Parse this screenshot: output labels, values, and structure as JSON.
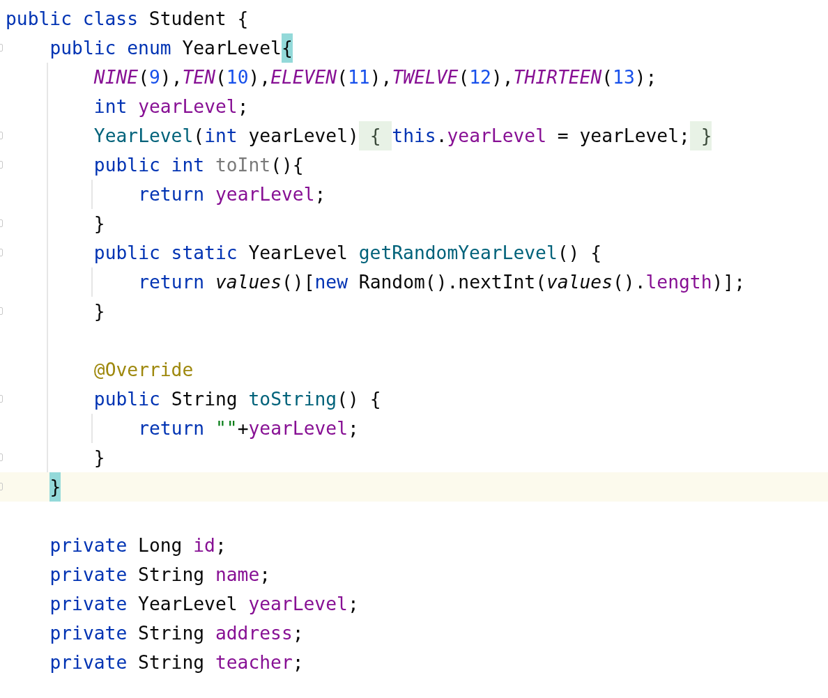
{
  "editor": {
    "lines": [
      {
        "kind": "code",
        "fold_marker": false,
        "current": false,
        "tokens": [
          {
            "text": "public class",
            "kind": "keyword"
          },
          {
            "text": " Student {",
            "kind": "plain"
          }
        ],
        "children": [
          {
            "kind": "code",
            "fold_marker": true,
            "current": false,
            "tokens": [
              {
                "text": "public enum",
                "kind": "keyword"
              },
              {
                "text": " YearLevel",
                "kind": "plain"
              },
              {
                "text": "{",
                "kind": "brace_match"
              }
            ],
            "children": [
              {
                "kind": "code",
                "fold_marker": false,
                "current": false,
                "tokens": [
                  {
                    "text": "NINE",
                    "kind": "constant"
                  },
                  {
                    "text": "(",
                    "kind": "plain"
                  },
                  {
                    "text": "9",
                    "kind": "number"
                  },
                  {
                    "text": "),",
                    "kind": "plain"
                  },
                  {
                    "text": "TEN",
                    "kind": "constant"
                  },
                  {
                    "text": "(",
                    "kind": "plain"
                  },
                  {
                    "text": "10",
                    "kind": "number"
                  },
                  {
                    "text": "),",
                    "kind": "plain"
                  },
                  {
                    "text": "ELEVEN",
                    "kind": "constant"
                  },
                  {
                    "text": "(",
                    "kind": "plain"
                  },
                  {
                    "text": "11",
                    "kind": "number"
                  },
                  {
                    "text": "),",
                    "kind": "plain"
                  },
                  {
                    "text": "TWELVE",
                    "kind": "constant"
                  },
                  {
                    "text": "(",
                    "kind": "plain"
                  },
                  {
                    "text": "12",
                    "kind": "number"
                  },
                  {
                    "text": "),",
                    "kind": "plain"
                  },
                  {
                    "text": "THIRTEEN",
                    "kind": "constant"
                  },
                  {
                    "text": "(",
                    "kind": "plain"
                  },
                  {
                    "text": "13",
                    "kind": "number"
                  },
                  {
                    "text": ");",
                    "kind": "plain"
                  }
                ]
              },
              {
                "kind": "code",
                "fold_marker": false,
                "current": false,
                "tokens": [
                  {
                    "text": "int ",
                    "kind": "keyword"
                  },
                  {
                    "text": "yearLevel",
                    "kind": "field"
                  },
                  {
                    "text": ";",
                    "kind": "plain"
                  }
                ]
              },
              {
                "kind": "code",
                "fold_marker": true,
                "current": false,
                "tokens": [
                  {
                    "text": "YearLevel",
                    "kind": "declaration"
                  },
                  {
                    "text": "(",
                    "kind": "plain"
                  },
                  {
                    "text": "int",
                    "kind": "keyword"
                  },
                  {
                    "text": " yearLevel)",
                    "kind": "plain"
                  },
                  {
                    "text": " { ",
                    "kind": "folded"
                  },
                  {
                    "text": "this",
                    "kind": "keyword"
                  },
                  {
                    "text": ".",
                    "kind": "plain"
                  },
                  {
                    "text": "yearLevel",
                    "kind": "field"
                  },
                  {
                    "text": " = yearLevel;",
                    "kind": "plain"
                  },
                  {
                    "text": " }",
                    "kind": "folded"
                  }
                ]
              },
              {
                "kind": "code",
                "fold_marker": true,
                "current": false,
                "tokens": [
                  {
                    "text": "public int ",
                    "kind": "keyword"
                  },
                  {
                    "text": "toInt",
                    "kind": "unused"
                  },
                  {
                    "text": "(){",
                    "kind": "plain"
                  }
                ],
                "children": [
                  {
                    "kind": "code",
                    "fold_marker": false,
                    "current": false,
                    "tokens": [
                      {
                        "text": "return ",
                        "kind": "keyword"
                      },
                      {
                        "text": "yearLevel",
                        "kind": "field"
                      },
                      {
                        "text": ";",
                        "kind": "plain"
                      }
                    ]
                  }
                ]
              },
              {
                "kind": "code",
                "fold_marker": true,
                "current": false,
                "tokens": [
                  {
                    "text": "}",
                    "kind": "plain"
                  }
                ]
              },
              {
                "kind": "code",
                "fold_marker": true,
                "current": false,
                "tokens": [
                  {
                    "text": "public static",
                    "kind": "keyword"
                  },
                  {
                    "text": " YearLevel ",
                    "kind": "plain"
                  },
                  {
                    "text": "getRandomYearLevel",
                    "kind": "declaration"
                  },
                  {
                    "text": "() {",
                    "kind": "plain"
                  }
                ],
                "children": [
                  {
                    "kind": "code",
                    "fold_marker": false,
                    "current": false,
                    "tokens": [
                      {
                        "text": "return ",
                        "kind": "keyword"
                      },
                      {
                        "text": "values",
                        "kind": "static_call"
                      },
                      {
                        "text": "()[",
                        "kind": "plain"
                      },
                      {
                        "text": "new",
                        "kind": "keyword"
                      },
                      {
                        "text": " Random().nextInt(",
                        "kind": "plain"
                      },
                      {
                        "text": "values",
                        "kind": "static_call"
                      },
                      {
                        "text": "().",
                        "kind": "plain"
                      },
                      {
                        "text": "length",
                        "kind": "field"
                      },
                      {
                        "text": ")];",
                        "kind": "plain"
                      }
                    ]
                  }
                ]
              },
              {
                "kind": "code",
                "fold_marker": true,
                "current": false,
                "tokens": [
                  {
                    "text": "}",
                    "kind": "plain"
                  }
                ]
              },
              {
                "kind": "blank"
              },
              {
                "kind": "code",
                "fold_marker": false,
                "current": false,
                "tokens": [
                  {
                    "text": "@Override",
                    "kind": "annotation"
                  }
                ]
              },
              {
                "kind": "code",
                "fold_marker": true,
                "current": false,
                "tokens": [
                  {
                    "text": "public",
                    "kind": "keyword"
                  },
                  {
                    "text": " String ",
                    "kind": "plain"
                  },
                  {
                    "text": "toString",
                    "kind": "declaration"
                  },
                  {
                    "text": "() {",
                    "kind": "plain"
                  }
                ],
                "children": [
                  {
                    "kind": "code",
                    "fold_marker": false,
                    "current": false,
                    "tokens": [
                      {
                        "text": "return ",
                        "kind": "keyword"
                      },
                      {
                        "text": "\"\"",
                        "kind": "string"
                      },
                      {
                        "text": "+",
                        "kind": "plain"
                      },
                      {
                        "text": "yearLevel",
                        "kind": "field"
                      },
                      {
                        "text": ";",
                        "kind": "plain"
                      }
                    ]
                  }
                ]
              },
              {
                "kind": "code",
                "fold_marker": true,
                "current": false,
                "tokens": [
                  {
                    "text": "}",
                    "kind": "plain"
                  }
                ]
              }
            ]
          },
          {
            "kind": "code",
            "fold_marker": true,
            "current": true,
            "tokens": [
              {
                "text": "}",
                "kind": "brace_match"
              }
            ]
          },
          {
            "kind": "blank"
          },
          {
            "kind": "code",
            "fold_marker": false,
            "current": false,
            "tokens": [
              {
                "text": "private",
                "kind": "keyword"
              },
              {
                "text": " Long ",
                "kind": "plain"
              },
              {
                "text": "id",
                "kind": "field"
              },
              {
                "text": ";",
                "kind": "plain"
              }
            ]
          },
          {
            "kind": "code",
            "fold_marker": false,
            "current": false,
            "tokens": [
              {
                "text": "private",
                "kind": "keyword"
              },
              {
                "text": " String ",
                "kind": "plain"
              },
              {
                "text": "name",
                "kind": "field"
              },
              {
                "text": ";",
                "kind": "plain"
              }
            ]
          },
          {
            "kind": "code",
            "fold_marker": false,
            "current": false,
            "tokens": [
              {
                "text": "private",
                "kind": "keyword"
              },
              {
                "text": " YearLevel ",
                "kind": "plain"
              },
              {
                "text": "yearLevel",
                "kind": "field"
              },
              {
                "text": ";",
                "kind": "plain"
              }
            ]
          },
          {
            "kind": "code",
            "fold_marker": false,
            "current": false,
            "tokens": [
              {
                "text": "private",
                "kind": "keyword"
              },
              {
                "text": " String ",
                "kind": "plain"
              },
              {
                "text": "address",
                "kind": "field"
              },
              {
                "text": ";",
                "kind": "plain"
              }
            ]
          },
          {
            "kind": "code",
            "fold_marker": false,
            "current": false,
            "tokens": [
              {
                "text": "private",
                "kind": "keyword"
              },
              {
                "text": " String ",
                "kind": "plain"
              },
              {
                "text": "teacher",
                "kind": "field"
              },
              {
                "text": ";",
                "kind": "plain"
              }
            ]
          }
        ]
      }
    ]
  }
}
